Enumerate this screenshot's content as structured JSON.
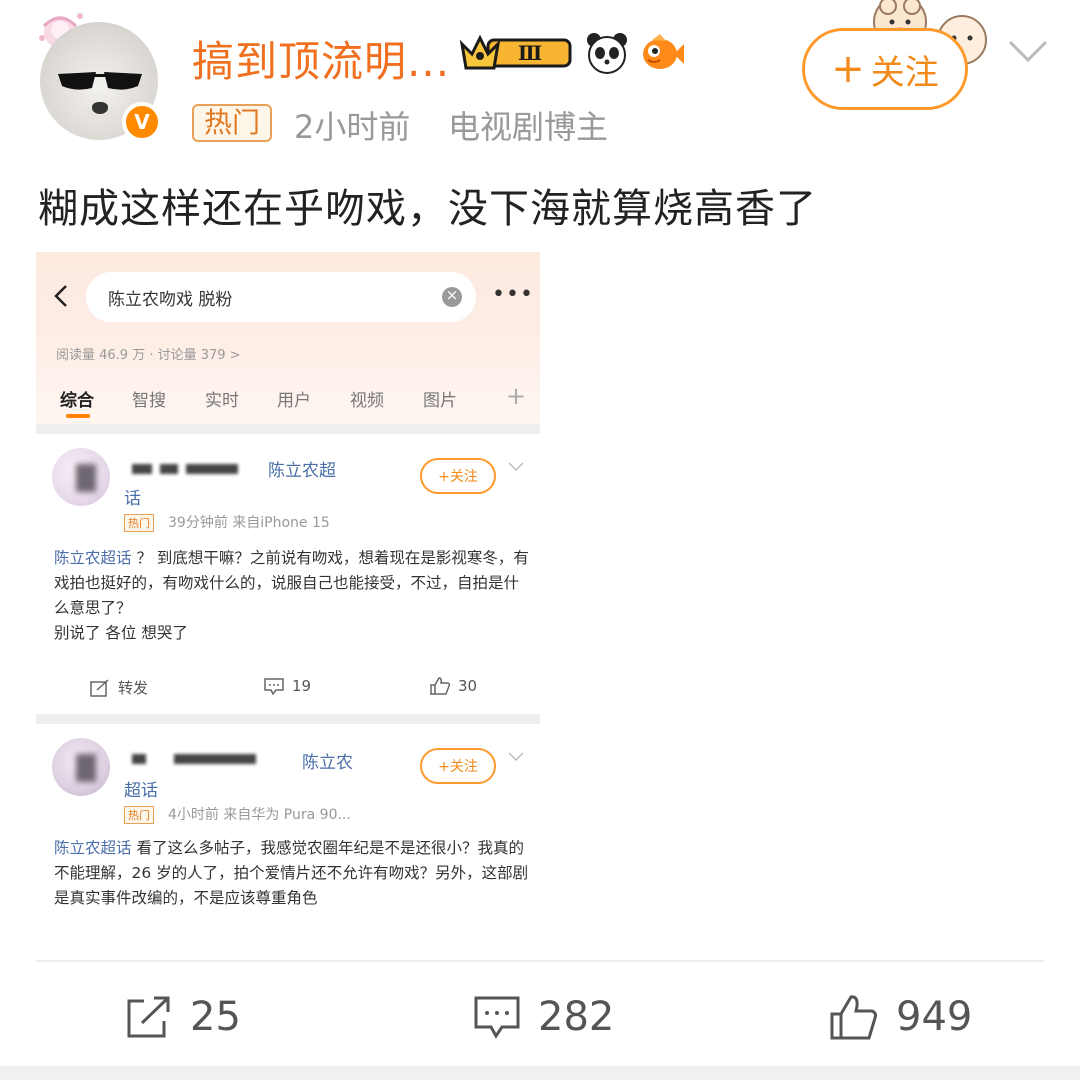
{
  "post": {
    "username": "搞到顶流明...",
    "level_badge": "Ⅲ",
    "hot_tag": "热门",
    "time": "2小时前",
    "role": "电视剧博主",
    "follow_label": "关注",
    "follow_plus": "+",
    "text": "糊成这样还在乎吻戏，没下海就算烧高香了",
    "avatar_badge": "V",
    "icons": [
      "avatar",
      "v-verified-badge",
      "crown-level-badge",
      "panda-icon",
      "fish-icon",
      "chevron-down-icon",
      "repost-icon",
      "comment-icon",
      "like-icon"
    ]
  },
  "screenshot": {
    "search_query": "陈立农吻戏 脱粉",
    "clear_icon": "×",
    "more_icon": "•••",
    "back_icon": "chevron-left-icon",
    "stats": "阅读量 46.9 万 · 讨论量 379 >",
    "tabs": [
      "综合",
      "智搜",
      "实时",
      "用户",
      "视频",
      "图片"
    ],
    "tabs_plus": "+",
    "cards": [
      {
        "name_suffix": "陈立农超",
        "name_line2": "话",
        "hot": "热门",
        "meta": "39分钟前  来自iPhone 15",
        "follow": "+关注",
        "topic": "陈立农超话",
        "body": " ？ 到底想干嘛？之前说有吻戏，想着现在是影视寒冬，有戏拍也挺好的，有吻戏什么的，说服自己也能接受，不过，自拍是什么意思了？",
        "body_line2": "别说了 各位 想哭了",
        "repost": "转发",
        "comments": "19",
        "likes": "30"
      },
      {
        "name_suffix": "陈立农",
        "name_line2": "超话",
        "hot": "热门",
        "meta": "4小时前  来自华为 Pura 90...",
        "follow": "+关注",
        "topic": "陈立农超话",
        "body": " 看了这么多帖子，我感觉农圈年纪是不是还很小？我真的不能理解，26 岁的人了，拍个爱情片还不允许有吻戏？另外，这部剧是真实事件改编的，不是应该尊重角色"
      }
    ]
  },
  "actions": {
    "repost_count": "25",
    "comment_count": "282",
    "like_count": "949"
  },
  "colors": {
    "accent_orange": "#f07020",
    "link_blue": "#4a6ea8",
    "meta_gray": "#999999"
  }
}
